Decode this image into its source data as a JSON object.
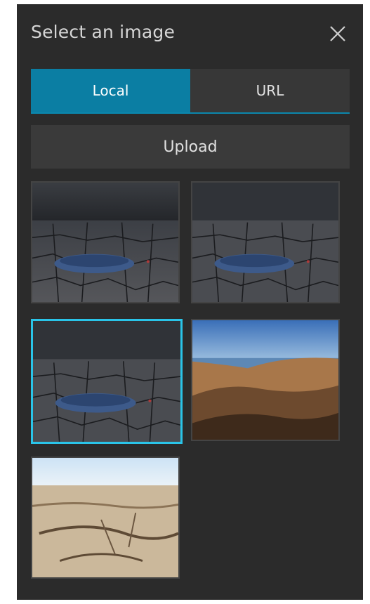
{
  "dialog": {
    "title": "Select an image",
    "close_icon": "close-icon"
  },
  "tabs": [
    {
      "label": "Local",
      "active": true
    },
    {
      "label": "URL",
      "active": false
    }
  ],
  "upload_label": "Upload",
  "thumbnails": [
    {
      "name": "boat-on-cracked-earth-1",
      "selected": false
    },
    {
      "name": "boat-on-cracked-earth-2",
      "selected": false
    },
    {
      "name": "boat-on-cracked-earth-3",
      "selected": true
    },
    {
      "name": "shoreline-dry-lake",
      "selected": false
    },
    {
      "name": "cracked-dry-ground",
      "selected": false
    }
  ],
  "colors": {
    "panel": "#2b2b2b",
    "accent": "#0b7ea3",
    "selected_border": "#2ac4e8"
  }
}
